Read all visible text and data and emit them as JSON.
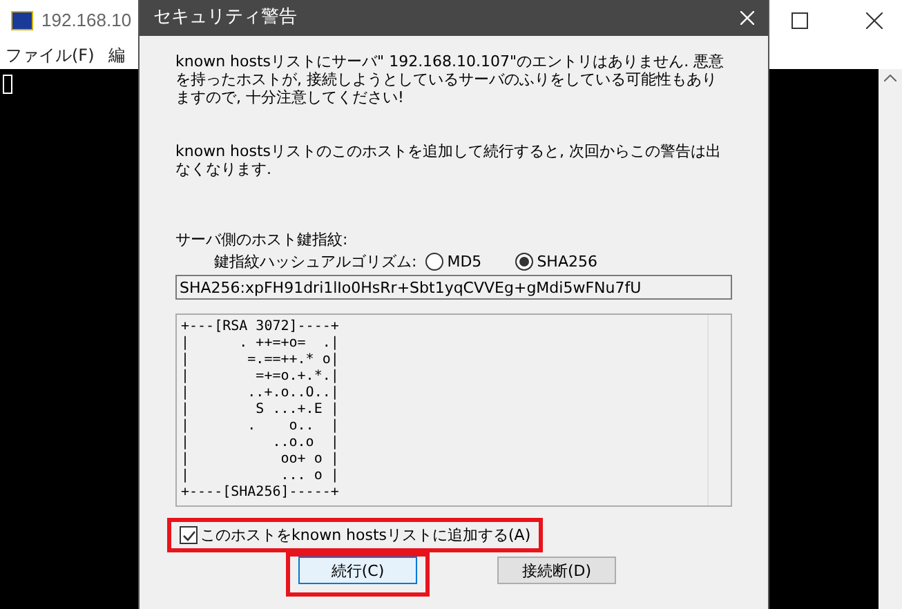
{
  "terminal": {
    "title": "192.168.10",
    "menu": [
      "ファイル(F)",
      "編"
    ]
  },
  "dialog": {
    "title": "セキュリティ警告",
    "message_1": "known hostsリストにサーバ\" 192.168.10.107\"のエントリはありません. 悪意を持ったホストが, 接続しようとしているサーバのふりをしている可能性もありますので, 十分注意してください!",
    "message_2": "known hostsリストのこのホストを追加して続行すると, 次回からこの警告は出なくなります.",
    "fingerprint_label": "サーバ側のホスト鍵指紋:",
    "hash_label": "鍵指紋ハッシュアルゴリズム:",
    "hash_options": [
      {
        "label": "MD5",
        "selected": false
      },
      {
        "label": "SHA256",
        "selected": true
      }
    ],
    "fingerprint": "SHA256:xpFH91dri1lIo0HsRr+Sbt1yqCVVEg+gMdi5wFNu7fU",
    "randomart": [
      "+---[RSA 3072]----+",
      "|      . ++=+o=  .|",
      "|       =.==++.* o|",
      "|        =+=o.+.*.|",
      "|       ..+.o..O..|",
      "|        S ...+.E |",
      "|       .    o..  |",
      "|          ..o.o  |",
      "|           oo+ o |",
      "|           ... o |",
      "+----[SHA256]-----+"
    ],
    "add_checkbox": {
      "label": "このホストをknown hostsリストに追加する(A)",
      "checked": true,
      "highlighted": true
    },
    "buttons": [
      {
        "label": "続行(C)",
        "default": true,
        "highlighted": true
      },
      {
        "label": "接続断(D)",
        "default": false,
        "highlighted": false
      }
    ]
  }
}
